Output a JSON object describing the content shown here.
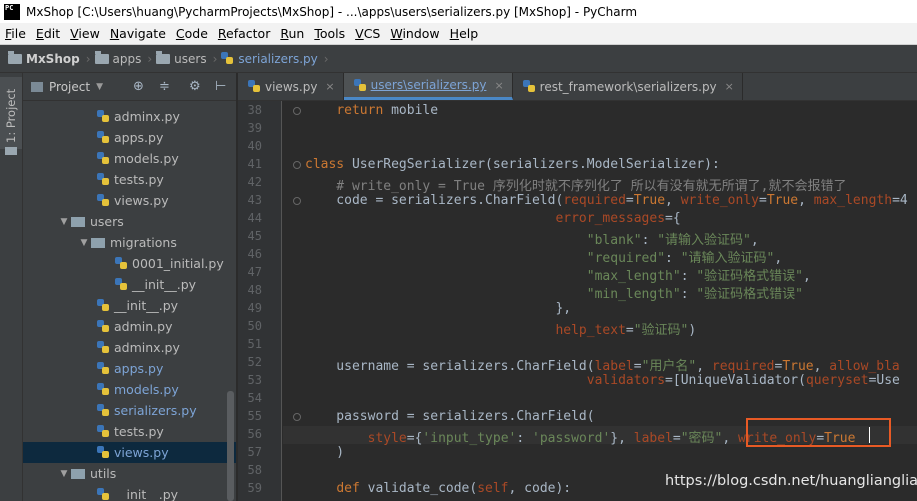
{
  "title_bar": {
    "icon": "PC",
    "text": "MxShop [C:\\Users\\huang\\PycharmProjects\\MxShop] - ...\\apps\\users\\serializers.py [MxShop] - PyCharm"
  },
  "menu": [
    {
      "u": "F",
      "rest": "ile"
    },
    {
      "u": "E",
      "rest": "dit"
    },
    {
      "u": "V",
      "rest": "iew"
    },
    {
      "u": "N",
      "rest": "avigate"
    },
    {
      "u": "C",
      "rest": "ode"
    },
    {
      "u": "R",
      "rest": "efactor"
    },
    {
      "u": "R",
      "rest": "un"
    },
    {
      "u": "T",
      "rest": "ools"
    },
    {
      "u": "V",
      "rest": "CS"
    },
    {
      "u": "W",
      "rest": "indow"
    },
    {
      "u": "H",
      "rest": "elp"
    }
  ],
  "breadcrumb": {
    "project": "MxShop",
    "dir1": "apps",
    "dir2": "users",
    "file": "serializers.py"
  },
  "toolstrip": {
    "project_tab": "1: Project"
  },
  "project_panel": {
    "label": "Project",
    "dropdown": "▼"
  },
  "tree": [
    {
      "name": "adminx.py",
      "kind": "py",
      "indent": 3,
      "blue": false
    },
    {
      "name": "apps.py",
      "kind": "py",
      "indent": 3,
      "blue": false
    },
    {
      "name": "models.py",
      "kind": "py",
      "indent": 3,
      "blue": false
    },
    {
      "name": "tests.py",
      "kind": "py",
      "indent": 3,
      "blue": false
    },
    {
      "name": "views.py",
      "kind": "py",
      "indent": 3,
      "blue": false
    },
    {
      "name": "users",
      "kind": "folder",
      "indent": 1,
      "blue": false
    },
    {
      "name": "migrations",
      "kind": "folder",
      "indent": 2,
      "blue": false
    },
    {
      "name": "0001_initial.py",
      "kind": "py",
      "indent": 4,
      "blue": false
    },
    {
      "name": "__init__.py",
      "kind": "py",
      "indent": 4,
      "blue": false
    },
    {
      "name": "__init__.py",
      "kind": "py",
      "indent": 3,
      "blue": false
    },
    {
      "name": "admin.py",
      "kind": "py",
      "indent": 3,
      "blue": false
    },
    {
      "name": "adminx.py",
      "kind": "py",
      "indent": 3,
      "blue": false
    },
    {
      "name": "apps.py",
      "kind": "py",
      "indent": 3,
      "blue": true
    },
    {
      "name": "models.py",
      "kind": "py",
      "indent": 3,
      "blue": true
    },
    {
      "name": "serializers.py",
      "kind": "py",
      "indent": 3,
      "blue": true
    },
    {
      "name": "tests.py",
      "kind": "py",
      "indent": 3,
      "blue": false
    },
    {
      "name": "views.py",
      "kind": "py",
      "indent": 3,
      "blue": true,
      "selected": true
    },
    {
      "name": "utils",
      "kind": "folder",
      "indent": 1,
      "blue": false
    },
    {
      "name": "__init__.py",
      "kind": "py",
      "indent": 3,
      "blue": false
    }
  ],
  "tabs": [
    {
      "label": "views.py",
      "active": false
    },
    {
      "label": "users\\serializers.py",
      "active": true
    },
    {
      "label": "rest_framework\\serializers.py",
      "active": false
    }
  ],
  "line_numbers": [
    "38",
    "39",
    "40",
    "41",
    "42",
    "43",
    "44",
    "45",
    "46",
    "47",
    "48",
    "49",
    "50",
    "51",
    "52",
    "53",
    "54",
    "55",
    "56",
    "57",
    "58",
    "59"
  ],
  "code_lines": [
    [
      [
        "    ",
        ""
      ],
      [
        "return",
        "k"
      ],
      [
        " mobile",
        ""
      ]
    ],
    [],
    [],
    [
      [
        "class",
        "k"
      ],
      [
        " UserRegSerializer(serializers.ModelSerializer):",
        ""
      ]
    ],
    [
      [
        "    # write_only = True 序列化时就不序列化了 所以有没有就无所谓了,就不会报错了",
        "c"
      ]
    ],
    [
      [
        "    code = serializers.CharField(",
        ""
      ],
      [
        "required",
        "p"
      ],
      [
        "=",
        ""
      ],
      [
        "True",
        "k"
      ],
      [
        ", ",
        ""
      ],
      [
        "write_only",
        "p"
      ],
      [
        "=",
        ""
      ],
      [
        "True",
        "k"
      ],
      [
        ", ",
        ""
      ],
      [
        "max_length",
        "p"
      ],
      [
        "=4",
        ""
      ]
    ],
    [
      [
        "                                ",
        ""
      ],
      [
        "error_messages",
        "p"
      ],
      [
        "={",
        ""
      ]
    ],
    [
      [
        "                                    ",
        ""
      ],
      [
        "\"blank\"",
        "s"
      ],
      [
        ": ",
        ""
      ],
      [
        "\"请输入验证码\"",
        "s"
      ],
      [
        ",",
        ""
      ]
    ],
    [
      [
        "                                    ",
        ""
      ],
      [
        "\"required\"",
        "s"
      ],
      [
        ": ",
        ""
      ],
      [
        "\"请输入验证码\"",
        "s"
      ],
      [
        ",",
        ""
      ]
    ],
    [
      [
        "                                    ",
        ""
      ],
      [
        "\"max_length\"",
        "s"
      ],
      [
        ": ",
        ""
      ],
      [
        "\"验证码格式错误\"",
        "s"
      ],
      [
        ",",
        ""
      ]
    ],
    [
      [
        "                                    ",
        ""
      ],
      [
        "\"min_length\"",
        "s"
      ],
      [
        ": ",
        ""
      ],
      [
        "\"验证码格式错误\"",
        "s"
      ]
    ],
    [
      [
        "                                }",
        ""
      ],
      [
        ",",
        ""
      ]
    ],
    [
      [
        "                                ",
        ""
      ],
      [
        "help_text",
        "p"
      ],
      [
        "=",
        ""
      ],
      [
        "\"验证码\"",
        "s"
      ],
      [
        ")",
        ""
      ]
    ],
    [],
    [
      [
        "    username = serializers.CharField(",
        ""
      ],
      [
        "label",
        "p"
      ],
      [
        "=",
        ""
      ],
      [
        "\"用户名\"",
        "s"
      ],
      [
        ", ",
        ""
      ],
      [
        "required",
        "p"
      ],
      [
        "=",
        ""
      ],
      [
        "True",
        "k"
      ],
      [
        ", ",
        ""
      ],
      [
        "allow_bla",
        "p"
      ]
    ],
    [
      [
        "                                    ",
        ""
      ],
      [
        "validators",
        "p"
      ],
      [
        "=[UniqueValidator(",
        ""
      ],
      [
        "queryset",
        "p"
      ],
      [
        "=Use",
        ""
      ]
    ],
    [],
    [
      [
        "    password = serializers.CharField(",
        ""
      ]
    ],
    [
      [
        "        ",
        ""
      ],
      [
        "style",
        "p"
      ],
      [
        "={",
        ""
      ],
      [
        "'input_type'",
        "s"
      ],
      [
        ": ",
        ""
      ],
      [
        "'password'",
        "s"
      ],
      [
        "}, ",
        ""
      ],
      [
        "label",
        "p"
      ],
      [
        "=",
        ""
      ],
      [
        "\"密码\"",
        "s"
      ],
      [
        ", ",
        ""
      ],
      [
        "write_only",
        "p"
      ],
      [
        "=",
        ""
      ],
      [
        "True",
        "k"
      ]
    ],
    [
      [
        "    )",
        ""
      ]
    ],
    [],
    [
      [
        "    ",
        ""
      ],
      [
        "def",
        "k"
      ],
      [
        " validate_code(",
        ""
      ],
      [
        "self",
        "p"
      ],
      [
        ", code):",
        ""
      ]
    ]
  ],
  "watermark": "https://blog.csdn.net/huangliangliangu"
}
